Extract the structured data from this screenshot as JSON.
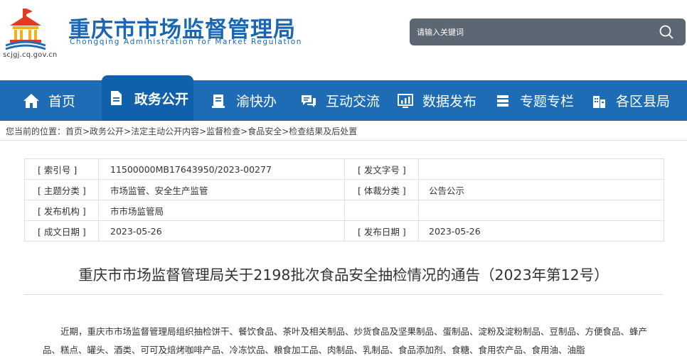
{
  "header": {
    "site_title": "重庆市市场监督管理局",
    "site_subtitle": "Chongqing  Administration for Market Regulation",
    "domain_text": "scjgj.cq.gov.cn",
    "search_placeholder": "请输入关键词"
  },
  "nav": {
    "items": [
      {
        "label": "首页",
        "icon": "home-icon"
      },
      {
        "label": "政务公开",
        "icon": "document-icon"
      },
      {
        "label": "渝快办",
        "icon": "service-icon"
      },
      {
        "label": "互动交流",
        "icon": "chat-icon"
      },
      {
        "label": "数据发布",
        "icon": "data-icon"
      },
      {
        "label": "专题专栏",
        "icon": "list-icon"
      },
      {
        "label": "各区县局",
        "icon": "building-icon"
      }
    ],
    "active_index": 1
  },
  "breadcrumb": "您当前的位置：首页>政务公开>法定主动公开内容>监督检查>食品安全>检查结果及后处置",
  "info": {
    "rows": [
      {
        "l1": "[ 索引号 ]",
        "v1": "11500000MB17643950/2023-00277",
        "l2": "[ 发文字号 ]",
        "v2": ""
      },
      {
        "l1": "[ 主题分类 ]",
        "v1": "市场监管、安全生产监管",
        "l2": "[ 体裁分类 ]",
        "v2": "公告公示"
      },
      {
        "l1": "[ 发布机构 ]",
        "v1": "市市场监管局",
        "l2": "",
        "v2": ""
      },
      {
        "l1": "[ 成文日期 ]",
        "v1": "2023-05-26",
        "l2": "[ 发布日期 ]",
        "v2": "2023-05-26"
      }
    ]
  },
  "article": {
    "title": "重庆市市场监督管理局关于2198批次食品安全抽检情况的通告（2023年第12号）",
    "body": "近期，重庆市市场监督管理局组织抽检饼干、餐饮食品、茶叶及相关制品、炒货食品及坚果制品、蛋制品、淀粉及淀粉制品、豆制品、方便食品、蜂产品、糕点、罐头、酒类、可可及焙烤咖啡产品、冷冻饮品、粮食加工品、肉制品、乳制品、食品添加剂、食糖、食用农产品、食用油、油脂"
  },
  "colors": {
    "brand_blue": "#1d6cb5",
    "nav_active": "#1160ac",
    "search_bg": "#5d6773"
  }
}
